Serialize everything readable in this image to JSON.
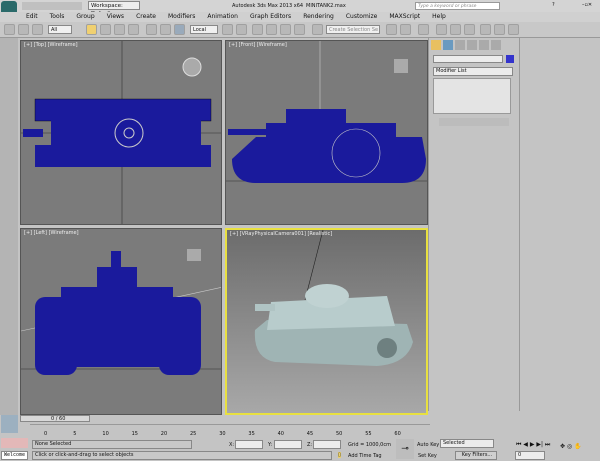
{
  "titlebar": {
    "workspace": "Workspace: Default",
    "title": "Autodesk 3ds Max  2013 x64",
    "file": "MINITANK2.max",
    "search_placeholder": "Type a keyword or phrase"
  },
  "menu": [
    "Edit",
    "Tools",
    "Group",
    "Views",
    "Create",
    "Modifiers",
    "Animation",
    "Graph Editors",
    "Rendering",
    "Customize",
    "MAXScript",
    "Help"
  ],
  "toolbar": {
    "filter": "All",
    "coord": "Local",
    "selection_set": "Create Selection Se"
  },
  "viewports": [
    {
      "label": "[+] [Top] [Wireframe]"
    },
    {
      "label": "[+] [Front] [Wireframe]"
    },
    {
      "label": "[+] [Left] [Wireframe]"
    },
    {
      "label": "[+] [VRayPhysicalCamera001] [Realistic]"
    }
  ],
  "command_panel": {
    "modifier_list": "Modifier List",
    "object_color": "#3333cc"
  },
  "timeline": {
    "frame": "0 / 60",
    "ticks": [
      "0",
      "5",
      "10",
      "15",
      "20",
      "25",
      "30",
      "35",
      "40",
      "45",
      "50",
      "55",
      "60"
    ]
  },
  "status": {
    "selection": "None Selected",
    "prompt": "Click or click-and-drag to select objects",
    "welcome": "Welcome",
    "x_label": "X:",
    "y_label": "Y:",
    "z_label": "Z:",
    "grid": "Grid = 1000,0cm",
    "add_time_tag": "Add Time Tag",
    "auto_key": "Auto Key",
    "set_key": "Set Key",
    "key_mode": "Selected",
    "key_filters": "Key Filters...",
    "current_frame": "0"
  },
  "colors": {
    "wire": "#1a1a9c",
    "active_border": "#e8e040"
  }
}
